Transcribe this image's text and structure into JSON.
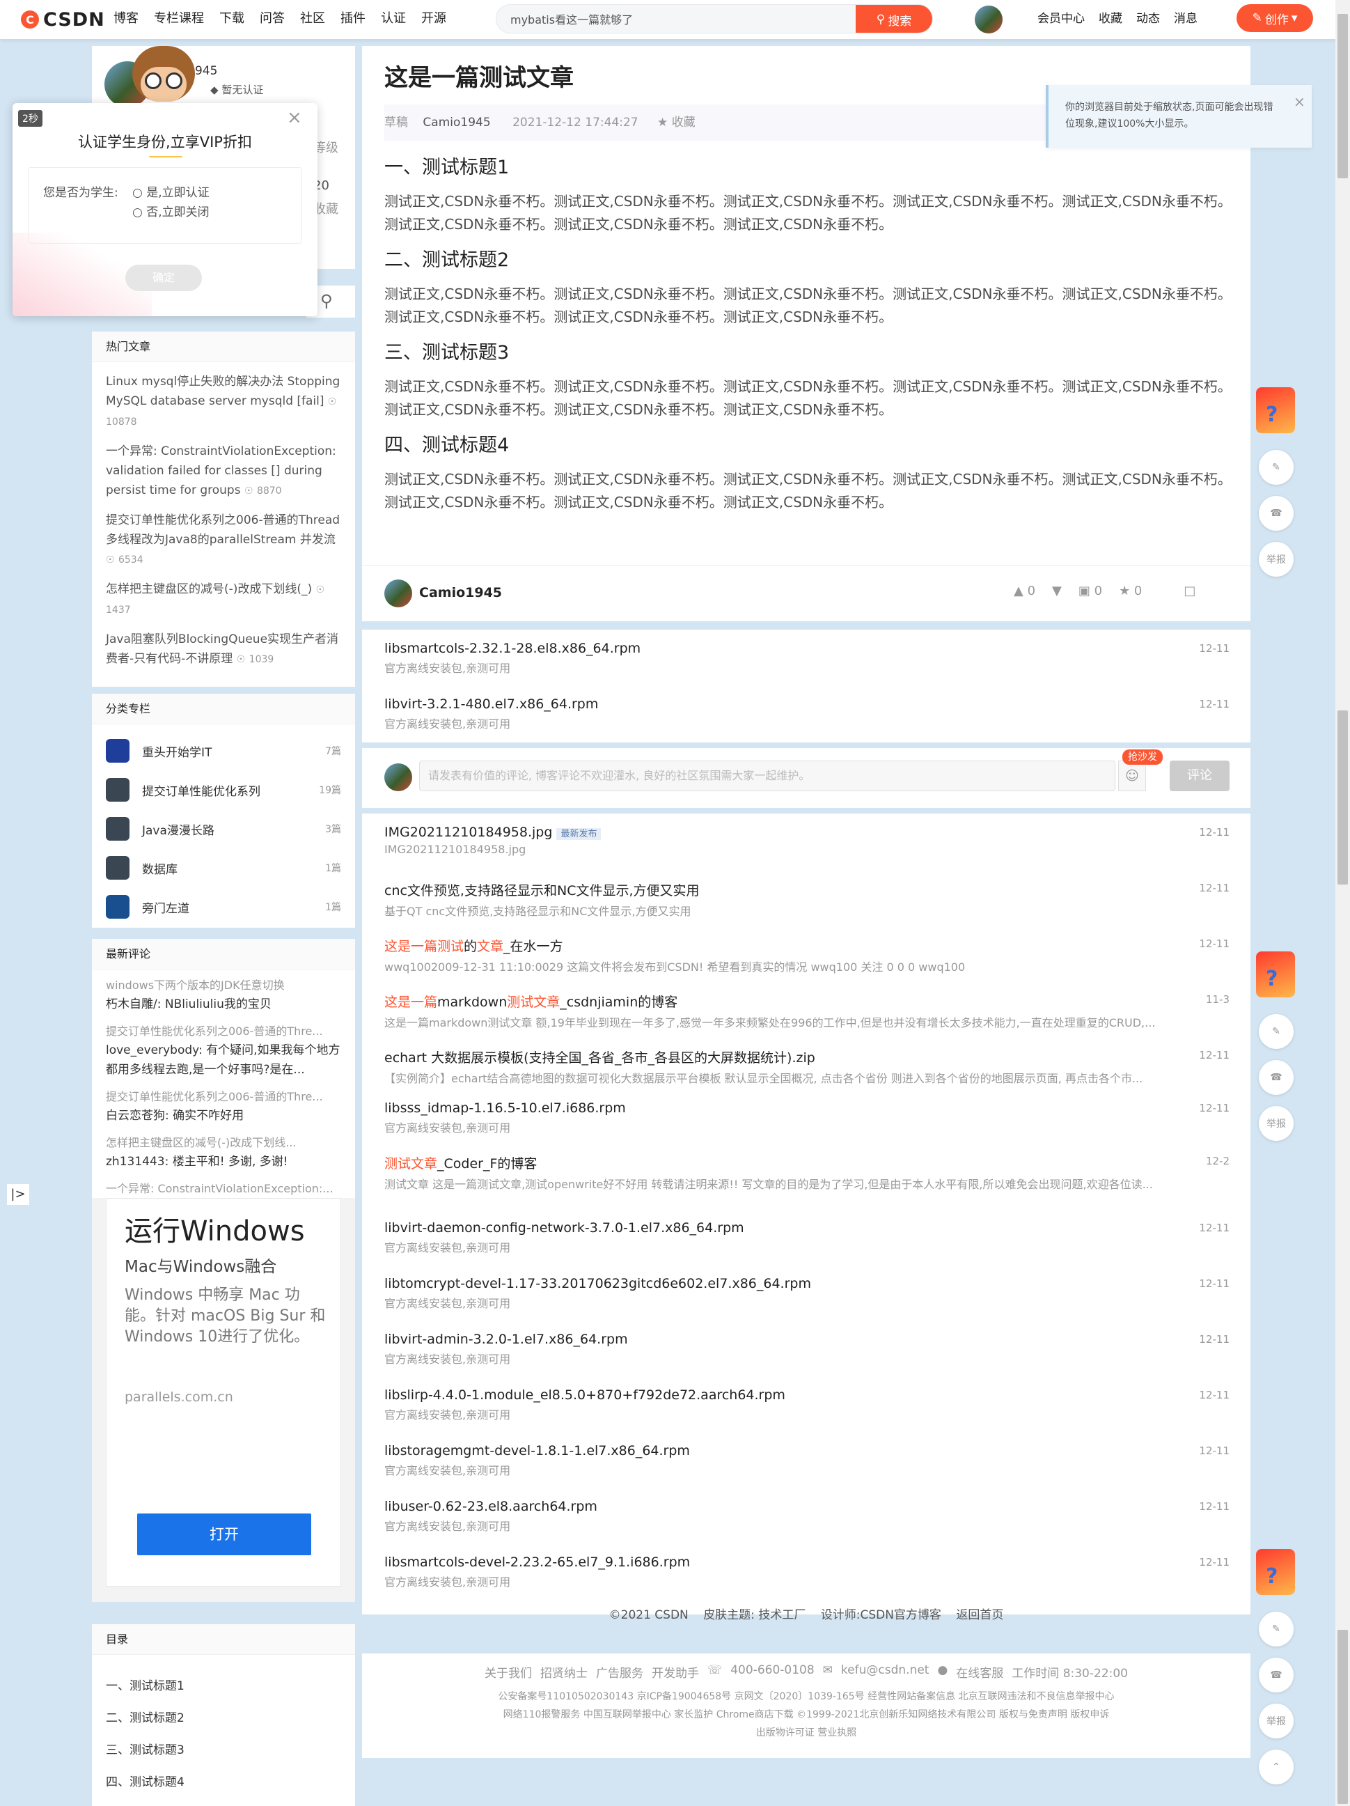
{
  "brand": {
    "logo_text": "CSDN"
  },
  "topnav": [
    "博客",
    "专栏课程",
    "下载",
    "问答",
    "社区",
    "插件",
    "认证",
    "开源"
  ],
  "search": {
    "value": "mybatis看这一篇就够了",
    "button": "搜索"
  },
  "usernav": [
    "会员中心",
    "收藏",
    "动态",
    "消息"
  ],
  "create_label": "创作",
  "author_card": {
    "name_fragment": "945",
    "cert": "暂无认证",
    "frag_level": "等级",
    "frag_num": "20",
    "frag_fav": "收藏"
  },
  "popup": {
    "timer": "2秒",
    "title": "认证学生身份,立享VIP折扣",
    "question": "您是否为学生:",
    "opt_yes": "是,立即认证",
    "opt_no": "否,立即关闭",
    "confirm": "确定"
  },
  "hot": {
    "title": "热门文章",
    "items": [
      {
        "text": "Linux mysql停止失败的解决办法 Stopping MySQL database server mysqld [fail]",
        "count": "10878"
      },
      {
        "text": "一个异常: ConstraintViolationException: validation failed for classes [] during persist time for groups",
        "count": "8870"
      },
      {
        "text": "提交订单性能优化系列之006-普通的Thread多线程改为Java8的parallelStream 并发流",
        "count": "6534"
      },
      {
        "text": "怎样把主键盘区的减号(-)改成下划线(_)",
        "count": "1437"
      },
      {
        "text": "Java阻塞队列BlockingQueue实现生产者消费者-只有代码-不讲原理",
        "count": "1039"
      }
    ]
  },
  "cats": {
    "title": "分类专栏",
    "items": [
      {
        "name": "重头开始学IT",
        "count": "7篇"
      },
      {
        "name": "提交订单性能优化系列",
        "count": "19篇"
      },
      {
        "name": "Java漫漫长路",
        "count": "3篇"
      },
      {
        "name": "数据库",
        "count": "1篇"
      },
      {
        "name": "旁门左道",
        "count": "1篇"
      }
    ]
  },
  "comments": {
    "title": "最新评论",
    "items": [
      {
        "a": "windows下两个版本的JDK任意切换",
        "b": "朽木自雕/: NBliuliuliu我的宝贝"
      },
      {
        "a": "提交订单性能优化系列之006-普通的Thre...",
        "b": "love_everybody: 有个疑问,如果我每个地方都用多线程去跑,是一个好事吗?是在..."
      },
      {
        "a": "提交订单性能优化系列之006-普通的Thre...",
        "b": "白云恋苍狗: 确实不咋好用"
      },
      {
        "a": "怎样把主键盘区的减号(-)改成下划线...",
        "b": "zh131443: 楼主平和! 多谢, 多谢!"
      },
      {
        "a": "一个异常: ConstraintViolationException:...",
        "b": ""
      }
    ]
  },
  "ad": {
    "headline": "运行Windows",
    "sub": "Mac与Windows融合",
    "body": "Windows 中畅享 Mac 功能。针对 macOS Big Sur 和Windows 10进行了优化。",
    "domain": "parallels.com.cn",
    "button": "打开"
  },
  "toc": {
    "title": "目录",
    "items": [
      "一、测试标题1",
      "二、测试标题2",
      "三、测试标题3",
      "四、测试标题4"
    ]
  },
  "article": {
    "title": "这是一篇测试文章",
    "tag": "草稿",
    "author": "Camio1945",
    "date": "2021-12-12 17:44:27",
    "fav": "收藏",
    "sections": [
      {
        "h": "一、测试标题1",
        "p": "测试正文,CSDN永垂不朽。测试正文,CSDN永垂不朽。测试正文,CSDN永垂不朽。测试正文,CSDN永垂不朽。测试正文,CSDN永垂不朽。测试正文,CSDN永垂不朽。测试正文,CSDN永垂不朽。测试正文,CSDN永垂不朽。"
      },
      {
        "h": "二、测试标题2",
        "p": "测试正文,CSDN永垂不朽。测试正文,CSDN永垂不朽。测试正文,CSDN永垂不朽。测试正文,CSDN永垂不朽。测试正文,CSDN永垂不朽。测试正文,CSDN永垂不朽。测试正文,CSDN永垂不朽。测试正文,CSDN永垂不朽。"
      },
      {
        "h": "三、测试标题3",
        "p": "测试正文,CSDN永垂不朽。测试正文,CSDN永垂不朽。测试正文,CSDN永垂不朽。测试正文,CSDN永垂不朽。测试正文,CSDN永垂不朽。测试正文,CSDN永垂不朽。测试正文,CSDN永垂不朽。测试正文,CSDN永垂不朽。"
      },
      {
        "h": "四、测试标题4",
        "p": "测试正文,CSDN永垂不朽。测试正文,CSDN永垂不朽。测试正文,CSDN永垂不朽。测试正文,CSDN永垂不朽。测试正文,CSDN永垂不朽。测试正文,CSDN永垂不朽。测试正文,CSDN永垂不朽。测试正文,CSDN永垂不朽。"
      }
    ],
    "footer_author": "Camio1945",
    "likes": "0",
    "comments": "0",
    "stars": "0"
  },
  "zoom_notice": "你的浏览器目前处于缩放状态,页面可能会出现错位现象,建议100%大小显示。",
  "related_top": [
    {
      "title": "libsmartcols-2.32.1-28.el8.x86_64.rpm",
      "desc": "官方离线安装包,亲测可用",
      "date": "12-11"
    },
    {
      "title": "libvirt-3.2.1-480.el7.x86_64.rpm",
      "desc": "官方离线安装包,亲测可用",
      "date": "12-11"
    }
  ],
  "comment_box": {
    "placeholder": "请发表有价值的评论, 博客评论不欢迎灌水, 良好的社区氛围需大家一起维护。",
    "badge": "抢沙发",
    "submit": "评论"
  },
  "related": [
    {
      "title": "IMG20211210184958.jpg",
      "badge": "最新发布",
      "desc": "IMG20211210184958.jpg",
      "date": "12-11"
    },
    {
      "title": "cnc文件预览,支持路径显示和NC文件显示,方便又实用",
      "desc": "基于QT cnc文件预览,支持路径显示和NC文件显示,方便又实用",
      "date": "12-11"
    },
    {
      "title_r1": "这是一篇测试",
      "title_m1": "的",
      "title_r2": "文章",
      "title_m2": "_在水一方",
      "desc": "wwq1002009-12-31 11:10:0029 这篇文件将会发布到CSDN! 希望看到真实的情况 wwq100 关注 0 0 0 wwq100",
      "date": "12-11"
    },
    {
      "title_r1": "这是一篇",
      "title_m1": "markdown",
      "title_r2": "测试文章",
      "title_m2": "_csdnjiamin的博客",
      "desc": "这是一篇markdown测试文章 额,19年毕业到现在一年多了,感觉一年多来频繁处在996的工作中,但是也并没有增长太多技术能力,一直在处理重复的CRUD,...",
      "date": "11-3"
    },
    {
      "title": "echart 大数据展示模板(支持全国_各省_各市_各县区的大屏数据统计).zip",
      "desc": "【实例简介】echart结合高德地图的数据可视化大数据展示平台模板 默认显示全国概况, 点击各个省份 则进入到各个省份的地图展示页面, 再点击各个市...",
      "date": "12-11"
    },
    {
      "title": "libsss_idmap-1.16.5-10.el7.i686.rpm",
      "desc": "官方离线安装包,亲测可用",
      "date": "12-11"
    },
    {
      "title_r1": "测试文章",
      "title_m1": "_Coder_F的博客",
      "title_r2": "",
      "title_m2": "",
      "desc": "测试文章 这是一篇测试文章,测试openwrite好不好用 转载请注明来源!! 写文章的目的是为了学习,但是由于本人水平有限,所以难免会出现问题,欢迎各位读...",
      "date": "12-2"
    },
    {
      "title": "libvirt-daemon-config-network-3.7.0-1.el7.x86_64.rpm",
      "desc": "官方离线安装包,亲测可用",
      "date": "12-11"
    },
    {
      "title": "libtomcrypt-devel-1.17-33.20170623gitcd6e602.el7.x86_64.rpm",
      "desc": "官方离线安装包,亲测可用",
      "date": "12-11"
    },
    {
      "title": "libvirt-admin-3.2.0-1.el7.x86_64.rpm",
      "desc": "官方离线安装包,亲测可用",
      "date": "12-11"
    },
    {
      "title": "libslirp-4.4.0-1.module_el8.5.0+870+f792de72.aarch64.rpm",
      "desc": "官方离线安装包,亲测可用",
      "date": "12-11"
    },
    {
      "title": "libstoragemgmt-devel-1.8.1-1.el7.x86_64.rpm",
      "desc": "官方离线安装包,亲测可用",
      "date": "12-11"
    },
    {
      "title": "libuser-0.62-23.el8.aarch64.rpm",
      "desc": "官方离线安装包,亲测可用",
      "date": "12-11"
    },
    {
      "title": "libsmartcols-devel-2.23.2-65.el7_9.1.i686.rpm",
      "desc": "官方离线安装包,亲测可用",
      "date": "12-11"
    }
  ],
  "skin": {
    "copyright": "©2021 CSDN",
    "theme": "皮肤主题: 技术工厂",
    "designer": "设计师:CSDN官方博客",
    "home": "返回首页"
  },
  "footer": {
    "line1": [
      "关于我们",
      "招贤纳士",
      "广告服务",
      "开发助手",
      "400-660-0108",
      "kefu@csdn.net",
      "在线客服",
      "工作时间 8:30-22:00"
    ],
    "line2": "公安备案号11010502030143  京ICP备19004658号  京网文〔2020〕1039-165号  经营性网站备案信息  北京互联网违法和不良信息举报中心",
    "line3": "网络110报警服务  中国互联网举报中心  家长监护  Chrome商店下载  ©1999-2021北京创新乐知网络技术有限公司  版权与免责声明  版权申诉",
    "line4": "出版物许可证  营业执照"
  },
  "float_labels": {
    "report": "举报"
  },
  "colors": {
    "brand": "#fc5531",
    "bg": "#d3e4f2"
  }
}
